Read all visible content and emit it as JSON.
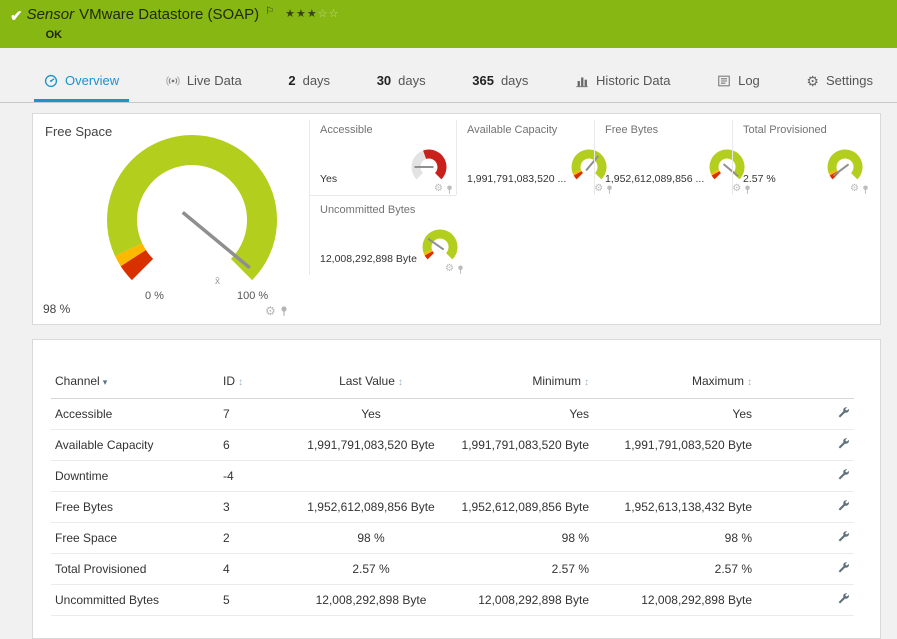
{
  "colors": {
    "header_green": "#86b712",
    "gauge_green": "#b4ce1e",
    "gauge_yellow": "#fdb800",
    "gauge_red": "#d93000",
    "accessible_red": "#c9201b",
    "active_tab_blue": "#1a93cf"
  },
  "icons": {
    "check": "✔",
    "flag": "⚐",
    "gear": "⚙",
    "sort_desc": "▾",
    "sort_both": "↕"
  },
  "header": {
    "kind": "Sensor",
    "title": "VMware Datastore (SOAP)",
    "status": "OK",
    "stars_filled": "★★★",
    "stars_empty": "☆☆"
  },
  "tabs": [
    {
      "label": "Overview"
    },
    {
      "label": "Live Data"
    },
    {
      "num": "2",
      "label": "days"
    },
    {
      "num": "30",
      "label": "days"
    },
    {
      "num": "365",
      "label": "days"
    },
    {
      "label": "Historic Data"
    },
    {
      "label": "Log"
    },
    {
      "label": "Settings"
    }
  ],
  "gauges": {
    "main": {
      "label": "Free Space",
      "value": "98 %",
      "percent": 98,
      "min_label": "0 %",
      "max_label": "100 %",
      "avg_symbol": "x̄"
    },
    "small": [
      {
        "label": "Accessible",
        "value": "Yes"
      },
      {
        "label": "Available Capacity",
        "value": "1,991,791,083,520 ..."
      },
      {
        "label": "Free Bytes",
        "value": "1,952,612,089,856 ..."
      },
      {
        "label": "Total Provisioned",
        "value": "2.57 %"
      },
      {
        "label": "Uncommitted Bytes",
        "value": "12,008,292,898 Byte"
      }
    ]
  },
  "table": {
    "columns": [
      {
        "label": "Channel"
      },
      {
        "label": "ID"
      },
      {
        "label": "Last Value"
      },
      {
        "label": "Minimum"
      },
      {
        "label": "Maximum"
      }
    ],
    "rows": [
      {
        "channel": "Accessible",
        "id": "7",
        "last": "Yes",
        "min": "Yes",
        "max": "Yes"
      },
      {
        "channel": "Available Capacity",
        "id": "6",
        "last": "1,991,791,083,520 Byte",
        "min": "1,991,791,083,520 Byte",
        "max": "1,991,791,083,520 Byte"
      },
      {
        "channel": "Downtime",
        "id": "-4",
        "last": "",
        "min": "",
        "max": ""
      },
      {
        "channel": "Free Bytes",
        "id": "3",
        "last": "1,952,612,089,856 Byte",
        "min": "1,952,612,089,856 Byte",
        "max": "1,952,613,138,432 Byte"
      },
      {
        "channel": "Free Space",
        "id": "2",
        "last": "98 %",
        "min": "98 %",
        "max": "98 %"
      },
      {
        "channel": "Total Provisioned",
        "id": "4",
        "last": "2.57 %",
        "min": "2.57 %",
        "max": "2.57 %"
      },
      {
        "channel": "Uncommitted Bytes",
        "id": "5",
        "last": "12,008,292,898 Byte",
        "min": "12,008,292,898 Byte",
        "max": "12,008,292,898 Byte"
      }
    ]
  }
}
